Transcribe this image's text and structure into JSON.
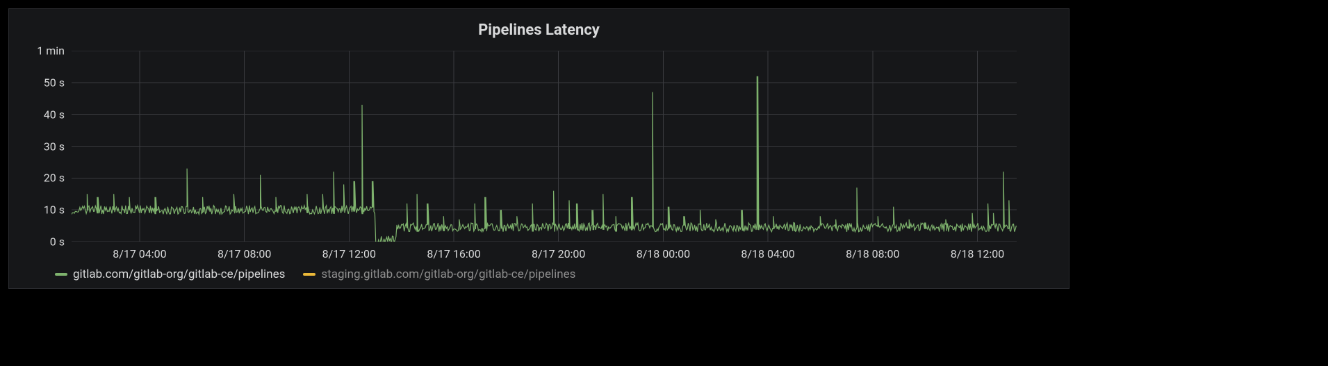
{
  "chart_data": {
    "type": "line",
    "title": "Pipelines Latency",
    "ylabel": "",
    "xlabel": "",
    "ylim": [
      0,
      60
    ],
    "y_unit": "seconds",
    "y_ticks": [
      {
        "value": 0,
        "label": "0 s"
      },
      {
        "value": 10,
        "label": "10 s"
      },
      {
        "value": 20,
        "label": "20 s"
      },
      {
        "value": 30,
        "label": "30 s"
      },
      {
        "value": 40,
        "label": "40 s"
      },
      {
        "value": 50,
        "label": "50 s"
      },
      {
        "value": 60,
        "label": "1 min"
      }
    ],
    "x_ticks": [
      {
        "hours": 4,
        "label": "8/17 04:00"
      },
      {
        "hours": 8,
        "label": "8/17 08:00"
      },
      {
        "hours": 12,
        "label": "8/17 12:00"
      },
      {
        "hours": 16,
        "label": "8/17 16:00"
      },
      {
        "hours": 20,
        "label": "8/17 20:00"
      },
      {
        "hours": 24,
        "label": "8/18 00:00"
      },
      {
        "hours": 28,
        "label": "8/18 04:00"
      },
      {
        "hours": 32,
        "label": "8/18 08:00"
      },
      {
        "hours": 36,
        "label": "8/18 12:00"
      }
    ],
    "x_range_hours": [
      1.4,
      37.5
    ],
    "series": [
      {
        "name": "gitlab.com/gitlab-org/gitlab-ce/pipelines",
        "color": "#7eb26d",
        "baseline_segments": [
          {
            "from_h": 1.4,
            "to_h": 13.0,
            "value": 10.0
          },
          {
            "from_h": 13.0,
            "to_h": 13.8,
            "value": 0.6
          },
          {
            "from_h": 13.8,
            "to_h": 37.5,
            "value": 4.5
          }
        ],
        "noise_amp": 1.4,
        "spikes": [
          {
            "h": 2.0,
            "v": 15
          },
          {
            "h": 2.4,
            "v": 14
          },
          {
            "h": 3.0,
            "v": 15
          },
          {
            "h": 3.6,
            "v": 14
          },
          {
            "h": 4.6,
            "v": 14
          },
          {
            "h": 5.8,
            "v": 23
          },
          {
            "h": 6.4,
            "v": 14
          },
          {
            "h": 7.6,
            "v": 15
          },
          {
            "h": 8.6,
            "v": 21
          },
          {
            "h": 9.2,
            "v": 14
          },
          {
            "h": 10.4,
            "v": 15
          },
          {
            "h": 11.0,
            "v": 15
          },
          {
            "h": 11.4,
            "v": 22
          },
          {
            "h": 11.8,
            "v": 18
          },
          {
            "h": 12.2,
            "v": 19
          },
          {
            "h": 12.5,
            "v": 43
          },
          {
            "h": 12.9,
            "v": 19
          },
          {
            "h": 14.2,
            "v": 12
          },
          {
            "h": 14.6,
            "v": 15
          },
          {
            "h": 15.0,
            "v": 12
          },
          {
            "h": 15.6,
            "v": 8
          },
          {
            "h": 16.2,
            "v": 7
          },
          {
            "h": 16.8,
            "v": 12
          },
          {
            "h": 17.2,
            "v": 14
          },
          {
            "h": 17.8,
            "v": 10
          },
          {
            "h": 18.4,
            "v": 8
          },
          {
            "h": 19.0,
            "v": 12
          },
          {
            "h": 19.8,
            "v": 16
          },
          {
            "h": 20.4,
            "v": 13
          },
          {
            "h": 20.7,
            "v": 12
          },
          {
            "h": 21.3,
            "v": 10
          },
          {
            "h": 21.7,
            "v": 15
          },
          {
            "h": 22.2,
            "v": 8
          },
          {
            "h": 22.8,
            "v": 14
          },
          {
            "h": 23.6,
            "v": 47
          },
          {
            "h": 24.2,
            "v": 11
          },
          {
            "h": 24.8,
            "v": 8
          },
          {
            "h": 25.4,
            "v": 10
          },
          {
            "h": 26.0,
            "v": 7
          },
          {
            "h": 27.0,
            "v": 10
          },
          {
            "h": 27.6,
            "v": 52
          },
          {
            "h": 28.2,
            "v": 8
          },
          {
            "h": 29.0,
            "v": 6
          },
          {
            "h": 30.0,
            "v": 8
          },
          {
            "h": 30.6,
            "v": 7
          },
          {
            "h": 31.4,
            "v": 17
          },
          {
            "h": 32.2,
            "v": 8
          },
          {
            "h": 32.8,
            "v": 11
          },
          {
            "h": 33.4,
            "v": 7
          },
          {
            "h": 34.0,
            "v": 6
          },
          {
            "h": 34.8,
            "v": 7
          },
          {
            "h": 35.8,
            "v": 9
          },
          {
            "h": 36.4,
            "v": 12
          },
          {
            "h": 36.6,
            "v": 9
          },
          {
            "h": 37.0,
            "v": 22
          },
          {
            "h": 37.2,
            "v": 13
          }
        ]
      },
      {
        "name": "staging.gitlab.com/gitlab-org/gitlab-ce/pipelines",
        "color": "#eab839",
        "baseline_segments": [],
        "noise_amp": 0,
        "spikes": []
      }
    ]
  }
}
